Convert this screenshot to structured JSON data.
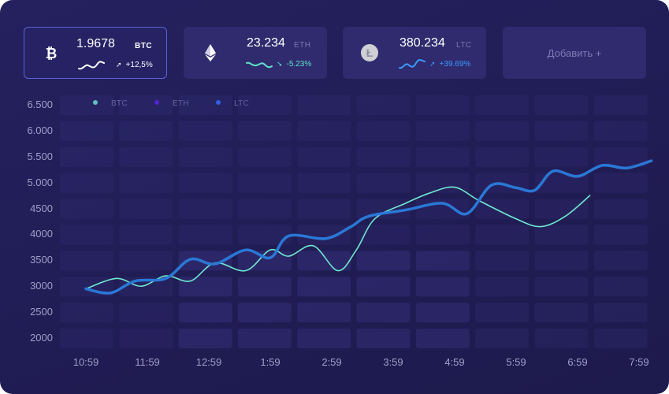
{
  "cards": [
    {
      "value": "1.9678",
      "ticker": "BTC",
      "change": "+12,5%",
      "icon": "bitcoin-icon",
      "accent": "#ffffff"
    },
    {
      "value": "23.234",
      "ticker": "ETH",
      "change": "-5.23%",
      "icon": "ethereum-icon",
      "accent": "#5fe3c8"
    },
    {
      "value": "380.234",
      "ticker": "LTC",
      "change": "+39.69%",
      "icon": "litecoin-icon",
      "accent": "#3b9bff"
    }
  ],
  "add_label": "Добавить +",
  "colors": {
    "btc": "#6ee8cf",
    "eth": "#5b1fe0",
    "ltc": "#2f6bff",
    "main_line": "#2a78d6"
  },
  "chart_data": {
    "type": "line",
    "legend": [
      "BTC",
      "ETH",
      "LTC"
    ],
    "y_tick_labels": [
      "6.500",
      "6.000",
      "5.500",
      "5.000",
      "4500",
      "4000",
      "3500",
      "3000",
      "2500",
      "2000"
    ],
    "x": [
      "10:59",
      "11:59",
      "12:59",
      "1:59",
      "2:59",
      "3:59",
      "4:59",
      "5:59",
      "6:59",
      "7:59"
    ],
    "ylim": [
      2000,
      6500
    ],
    "grid": true,
    "series": [
      {
        "name": "BTC",
        "points": [
          [
            0,
            2950
          ],
          [
            0.5,
            3150
          ],
          [
            0.9,
            3000
          ],
          [
            1.3,
            3200
          ],
          [
            1.7,
            3100
          ],
          [
            2.1,
            3450
          ],
          [
            2.6,
            3300
          ],
          [
            3.0,
            3700
          ],
          [
            3.3,
            3580
          ],
          [
            3.7,
            3780
          ],
          [
            4.1,
            3300
          ],
          [
            4.4,
            3700
          ],
          [
            4.7,
            4300
          ],
          [
            5.2,
            4600
          ],
          [
            5.6,
            4800
          ],
          [
            6.0,
            4910
          ],
          [
            6.4,
            4650
          ],
          [
            7.0,
            4300
          ],
          [
            7.4,
            4150
          ],
          [
            7.8,
            4350
          ],
          [
            8.2,
            4750
          ]
        ]
      },
      {
        "name": "LTC",
        "points": [
          [
            0,
            2950
          ],
          [
            0.4,
            2870
          ],
          [
            0.8,
            3100
          ],
          [
            1.3,
            3150
          ],
          [
            1.7,
            3520
          ],
          [
            2.1,
            3430
          ],
          [
            2.6,
            3700
          ],
          [
            3.0,
            3550
          ],
          [
            3.3,
            3970
          ],
          [
            3.9,
            3920
          ],
          [
            4.3,
            4140
          ],
          [
            4.6,
            4350
          ],
          [
            5.2,
            4470
          ],
          [
            5.8,
            4600
          ],
          [
            6.2,
            4400
          ],
          [
            6.6,
            4950
          ],
          [
            7.0,
            4900
          ],
          [
            7.3,
            4850
          ],
          [
            7.6,
            5220
          ],
          [
            8.0,
            5120
          ],
          [
            8.4,
            5330
          ],
          [
            8.8,
            5280
          ],
          [
            9.2,
            5420
          ]
        ]
      }
    ]
  }
}
